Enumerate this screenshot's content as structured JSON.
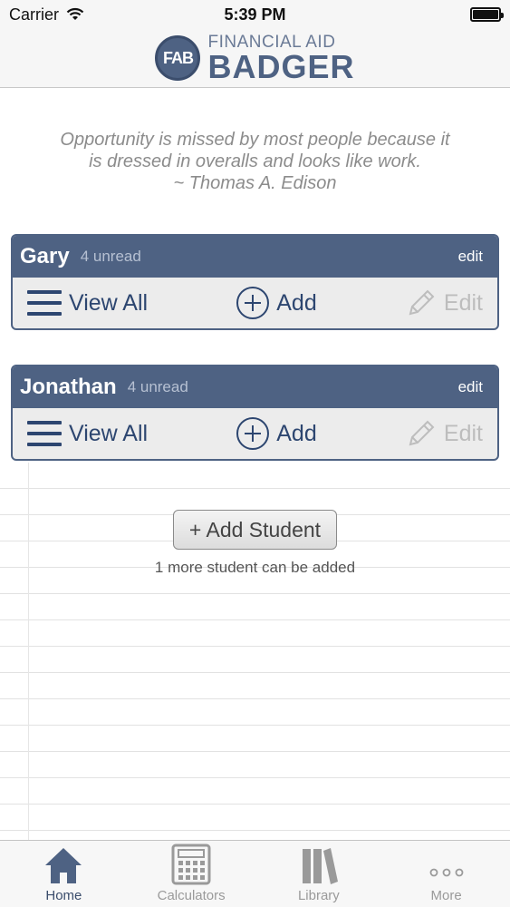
{
  "status_bar": {
    "carrier": "Carrier",
    "time": "5:39 PM"
  },
  "header": {
    "logo_initials": "FAB",
    "logo_top": "FINANCIAL AID",
    "logo_bottom": "BADGER"
  },
  "quote": {
    "line1": "Opportunity is missed by most people because it",
    "line2": "is dressed in overalls and looks like work.",
    "author": "~ Thomas A. Edison"
  },
  "students": [
    {
      "name": "Gary",
      "unread": "4 unread",
      "edit_label": "edit",
      "view_all_label": "View All",
      "add_label": "Add",
      "edit_action_label": "Edit"
    },
    {
      "name": "Jonathan",
      "unread": "4 unread",
      "edit_label": "edit",
      "view_all_label": "View All",
      "add_label": "Add",
      "edit_action_label": "Edit"
    }
  ],
  "add_student": {
    "button_label": "+ Add Student",
    "note": "1 more student can be added"
  },
  "tabbar": {
    "items": [
      {
        "label": "Home",
        "icon": "home-icon",
        "active": true
      },
      {
        "label": "Calculators",
        "icon": "calculator-icon",
        "active": false
      },
      {
        "label": "Library",
        "icon": "library-icon",
        "active": false
      },
      {
        "label": "More",
        "icon": "more-icon",
        "active": false
      }
    ]
  },
  "colors": {
    "brand": "#4e6283",
    "action_text": "#2d4670",
    "disabled": "#bdbdbd"
  }
}
